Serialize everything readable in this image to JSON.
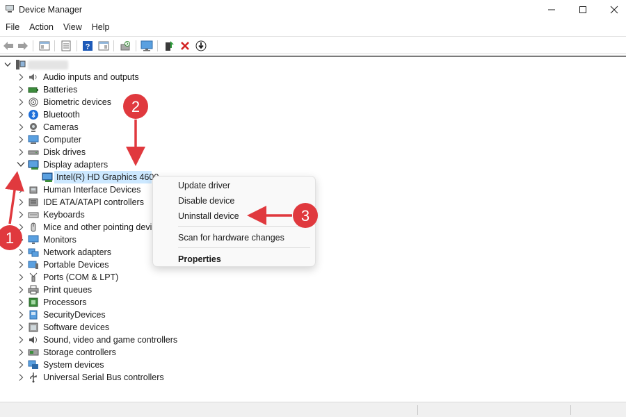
{
  "window": {
    "title": "Device Manager"
  },
  "menubar": {
    "items": [
      "File",
      "Action",
      "View",
      "Help"
    ]
  },
  "toolbar": {
    "buttons": [
      "back-arrow-icon",
      "forward-arrow-icon",
      "show-hide-console-tree-icon",
      "properties-icon",
      "help-icon",
      "action-pane-icon",
      "scan-hardware-icon",
      "monitor-icon",
      "update-driver-icon",
      "uninstall-x-icon",
      "download-arrow-icon"
    ]
  },
  "tree": {
    "root_label": "",
    "categories": [
      {
        "label": "Audio inputs and outputs",
        "icon": "speaker-icon"
      },
      {
        "label": "Batteries",
        "icon": "battery-icon"
      },
      {
        "label": "Biometric devices",
        "icon": "fingerprint-icon"
      },
      {
        "label": "Bluetooth",
        "icon": "bluetooth-icon"
      },
      {
        "label": "Cameras",
        "icon": "camera-icon"
      },
      {
        "label": "Computer",
        "icon": "computer-icon"
      },
      {
        "label": "Disk drives",
        "icon": "disk-drive-icon"
      },
      {
        "label": "Display adapters",
        "icon": "display-adapter-icon",
        "expanded": true
      },
      {
        "label": "Human Interface Devices",
        "icon": "hid-icon"
      },
      {
        "label": "IDE ATA/ATAPI controllers",
        "icon": "ide-controller-icon"
      },
      {
        "label": "Keyboards",
        "icon": "keyboard-icon"
      },
      {
        "label": "Mice and other pointing devi",
        "icon": "mouse-icon"
      },
      {
        "label": "Monitors",
        "icon": "monitor-icon"
      },
      {
        "label": "Network adapters",
        "icon": "network-adapter-icon"
      },
      {
        "label": "Portable Devices",
        "icon": "portable-device-icon"
      },
      {
        "label": "Ports (COM & LPT)",
        "icon": "port-icon"
      },
      {
        "label": "Print queues",
        "icon": "printer-icon"
      },
      {
        "label": "Processors",
        "icon": "processor-icon"
      },
      {
        "label": "SecurityDevices",
        "icon": "security-device-icon"
      },
      {
        "label": "Software devices",
        "icon": "software-device-icon"
      },
      {
        "label": "Sound, video and game controllers",
        "icon": "sound-icon"
      },
      {
        "label": "Storage controllers",
        "icon": "storage-controller-icon"
      },
      {
        "label": "System devices",
        "icon": "system-device-icon"
      },
      {
        "label": "Universal Serial Bus controllers",
        "icon": "usb-icon"
      }
    ],
    "selected_child": {
      "label": "Intel(R) HD Graphics 4600",
      "icon": "display-adapter-icon"
    }
  },
  "context_menu": {
    "items": [
      {
        "label": "Update driver"
      },
      {
        "label": "Disable device"
      },
      {
        "label": "Uninstall device"
      },
      {
        "label": "Scan for hardware changes"
      },
      {
        "label": "Properties",
        "bold": true
      }
    ]
  },
  "annotations": {
    "badges": [
      "1",
      "2",
      "3"
    ],
    "color": "#e0393e"
  },
  "colors": {
    "selection": "#cce8ff",
    "accent": "#0078d4"
  }
}
